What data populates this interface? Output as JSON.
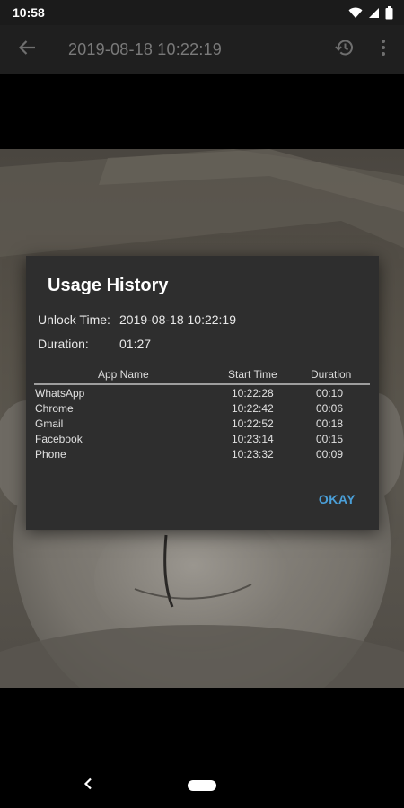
{
  "status_bar": {
    "time": "10:58",
    "icons": [
      "wifi-icon",
      "signal-icon",
      "battery-icon"
    ]
  },
  "app_bar": {
    "title": "2019-08-18 10:22:19",
    "back_icon": "arrow-back-icon",
    "history_icon": "history-icon",
    "more_icon": "more-vert-icon"
  },
  "dialog": {
    "title": "Usage History",
    "unlock_time_label": "Unlock Time:",
    "unlock_time_value": "2019-08-18 10:22:19",
    "duration_label": "Duration:",
    "duration_value": "01:27",
    "columns": {
      "app": "App Name",
      "start": "Start Time",
      "duration": "Duration"
    },
    "rows": [
      {
        "app": "WhatsApp",
        "start": "10:22:28",
        "duration": "00:10"
      },
      {
        "app": "Chrome",
        "start": "10:22:42",
        "duration": "00:06"
      },
      {
        "app": "Gmail",
        "start": "10:22:52",
        "duration": "00:18"
      },
      {
        "app": "Facebook",
        "start": "10:23:14",
        "duration": "00:15"
      },
      {
        "app": "Phone",
        "start": "10:23:32",
        "duration": "00:09"
      }
    ],
    "okay_label": "OKAY",
    "accent_color": "#4a9fd8"
  },
  "nav_bar": {
    "back_icon": "nav-back-icon",
    "home_icon": "nav-home-pill-icon"
  }
}
